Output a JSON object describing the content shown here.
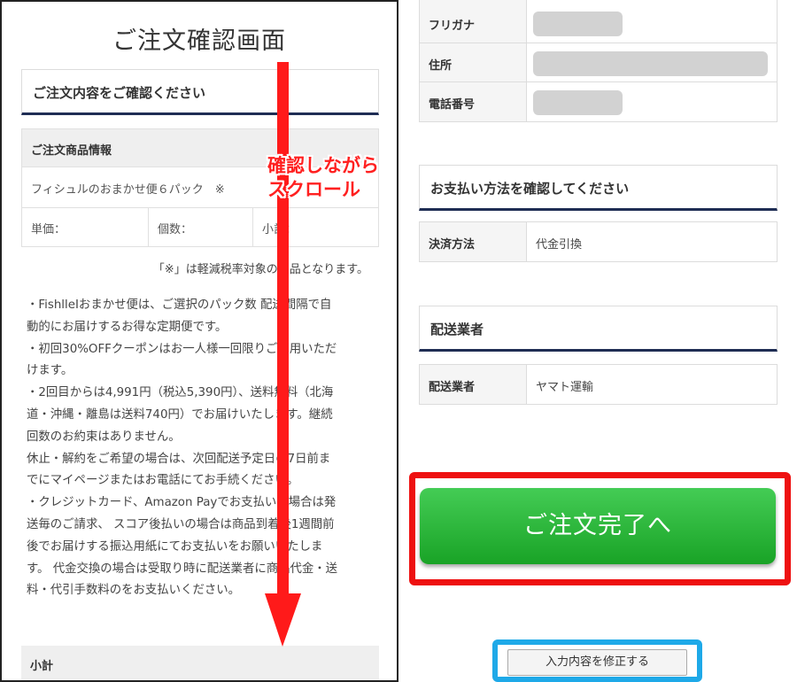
{
  "left": {
    "page_title": "ご注文確認画面",
    "section_title": "ご注文内容をご確認ください",
    "product_info_header": "ご注文商品情報",
    "product_name": "フィシュルのおまかせ便６パック　※",
    "price_labels": [
      "単価：",
      "個数：",
      "小計："
    ],
    "tax_note": "「※」は軽減税率対象の商品となります。",
    "description_lines": [
      "・FishlleIおまかせ便は、ご選択のパック数 配送間隔で自",
      "動的にお届けするお得な定期便です。",
      "・初回30%OFFクーポンはお一人様一回限りご利用いただ",
      "けます。",
      "・2回目からは4,991円（税込5,390円）、送料無料（北海",
      "道・沖縄・離島は送料740円）でお届けいたします。継続",
      "回数のお約束はありません。",
      "休止・解約をご希望の場合は、次回配送予定日の7日前ま",
      "でにマイページまたはお電話にてお手続ください。",
      "・クレジットカード、Amazon Payでお支払いの場合は発",
      "送毎のご請求、 スコア後払いの場合は商品到着後1週間前",
      "後でお届けする振込用紙にてお支払いをお願いいたしま",
      "す。 代金交換の場合は受取り時に配送業者に商品代金・送",
      "料・代引手数料のをお支払いください。"
    ],
    "subtotal_label": "小計",
    "scroll_annotation": [
      "確認しながら",
      "スクロール"
    ]
  },
  "right": {
    "personal_rows": [
      {
        "label": "",
        "redacted": false
      },
      {
        "label": "フリガナ",
        "redacted": true
      },
      {
        "label": "住所",
        "redacted": true
      },
      {
        "label": "電話番号",
        "redacted": true
      }
    ],
    "payment_section_title": "お支払い方法を確認してください",
    "payment_label": "決済方法",
    "payment_value": "代金引換",
    "carrier_section_title": "配送業者",
    "carrier_label": "配送業者",
    "carrier_value": "ヤマト運輸",
    "complete_button": "ご注文完了へ",
    "edit_button": "入力内容を修正する"
  },
  "colors": {
    "accent_navy": "#1f2d54",
    "cta_green": "#22b030",
    "highlight_red": "#ee1111",
    "highlight_blue": "#1ea9e8",
    "arrow_red": "#ff1a1a"
  }
}
